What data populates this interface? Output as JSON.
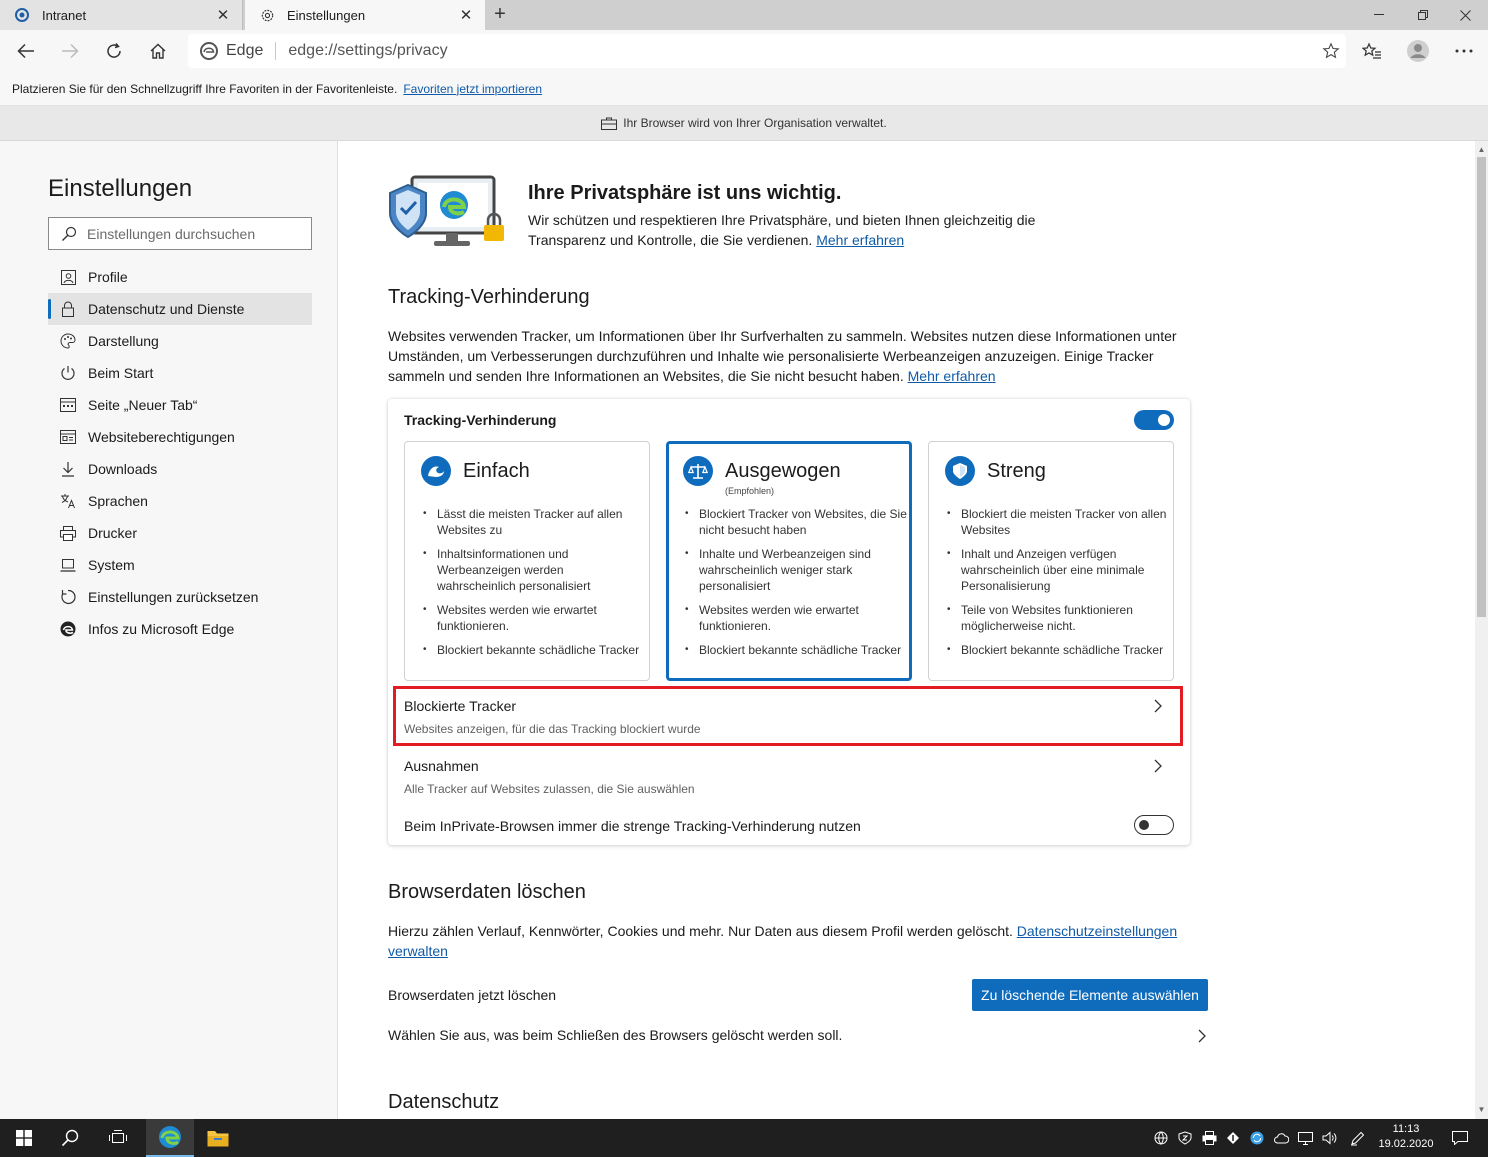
{
  "tabs": [
    {
      "title": "Intranet",
      "icon": "intranet-icon"
    },
    {
      "title": "Einstellungen",
      "icon": "gear-icon"
    }
  ],
  "toolbar": {
    "brand": "Edge",
    "url": "edge://settings/privacy"
  },
  "favbar": {
    "text": "Platzieren Sie für den Schnellzugriff Ihre Favoriten in der Favoritenleiste.",
    "link": "Favoriten jetzt importieren"
  },
  "managed_text": "Ihr Browser wird von Ihrer Organisation verwaltet.",
  "sidebar": {
    "title": "Einstellungen",
    "search_placeholder": "Einstellungen durchsuchen",
    "items": [
      {
        "label": "Profile",
        "icon": "profile-icon"
      },
      {
        "label": "Datenschutz und Dienste",
        "icon": "lock-icon",
        "selected": true
      },
      {
        "label": "Darstellung",
        "icon": "palette-icon"
      },
      {
        "label": "Beim Start",
        "icon": "power-icon"
      },
      {
        "label": "Seite „Neuer Tab“",
        "icon": "newtab-icon"
      },
      {
        "label": "Websiteberechtigungen",
        "icon": "permissions-icon"
      },
      {
        "label": "Downloads",
        "icon": "download-icon"
      },
      {
        "label": "Sprachen",
        "icon": "language-icon"
      },
      {
        "label": "Drucker",
        "icon": "printer-icon"
      },
      {
        "label": "System",
        "icon": "laptop-icon"
      },
      {
        "label": "Einstellungen zurücksetzen",
        "icon": "reset-icon"
      },
      {
        "label": "Infos zu Microsoft Edge",
        "icon": "edge-icon"
      }
    ]
  },
  "hero": {
    "title": "Ihre Privatsphäre ist uns wichtig.",
    "text": "Wir schützen und respektieren Ihre Privatsphäre, und bieten Ihnen gleichzeitig die Transparenz und Kontrolle, die Sie verdienen.",
    "link": "Mehr erfahren"
  },
  "tracking": {
    "heading": "Tracking-Verhinderung",
    "description": "Websites verwenden Tracker, um Informationen über Ihr Surfverhalten zu sammeln. Websites nutzen diese Informationen unter Umständen, um Verbesserungen durchzuführen und Inhalte wie personalisierte Werbeanzeigen anzuzeigen. Einige Tracker sammeln und senden Ihre Informationen an Websites, die Sie nicht besucht haben.",
    "link": "Mehr erfahren",
    "card_title": "Tracking-Verhinderung",
    "enabled": true,
    "levels": [
      {
        "name": "Einfach",
        "sub": "",
        "selected": false,
        "icon": "wave-icon",
        "bullets": [
          "Lässt die meisten Tracker auf allen Websites zu",
          "Inhaltsinformationen und Werbeanzeigen werden wahrscheinlich personalisiert",
          "Websites werden wie erwartet funktionieren.",
          "Blockiert bekannte schädliche Tracker"
        ]
      },
      {
        "name": "Ausgewogen",
        "sub": "(Empfohlen)",
        "selected": true,
        "icon": "scale-icon",
        "bullets": [
          "Blockiert Tracker von Websites, die Sie nicht besucht haben",
          "Inhalte und Werbeanzeigen sind wahrscheinlich weniger stark personalisiert",
          "Websites werden wie erwartet funktionieren.",
          "Blockiert bekannte schädliche Tracker"
        ]
      },
      {
        "name": "Streng",
        "sub": "",
        "selected": false,
        "icon": "shield-icon",
        "bullets": [
          "Blockiert die meisten Tracker von allen Websites",
          "Inhalt und Anzeigen verfügen wahrscheinlich über eine minimale Personalisierung",
          "Teile von Websites funktionieren möglicherweise nicht.",
          "Blockiert bekannte schädliche Tracker"
        ]
      }
    ],
    "blocked_title": "Blockierte Tracker",
    "blocked_sub": "Websites anzeigen, für die das Tracking blockiert wurde",
    "exceptions_title": "Ausnahmen",
    "exceptions_sub": "Alle Tracker auf Websites zulassen, die Sie auswählen",
    "inprivate_label": "Beim InPrivate-Browsen immer die strenge Tracking-Verhinderung nutzen",
    "inprivate_enabled": false
  },
  "browserdata": {
    "heading": "Browserdaten löschen",
    "text": "Hierzu zählen Verlauf, Kennwörter, Cookies und mehr. Nur Daten aus diesem Profil werden gelöscht.",
    "link": "Datenschutzeinstellungen verwalten",
    "clear_now_label": "Browserdaten jetzt löschen",
    "clear_button": "Zu löschende Elemente auswählen",
    "on_close_label": "Wählen Sie aus, was beim Schließen des Browsers gelöscht werden soll."
  },
  "datenschutz_heading": "Datenschutz",
  "taskbar": {
    "time": "11:13",
    "date": "19.02.2020"
  },
  "colors": {
    "accent": "#0f6cbd",
    "highlight": "#e31b23",
    "link": "#0f5ba7"
  }
}
